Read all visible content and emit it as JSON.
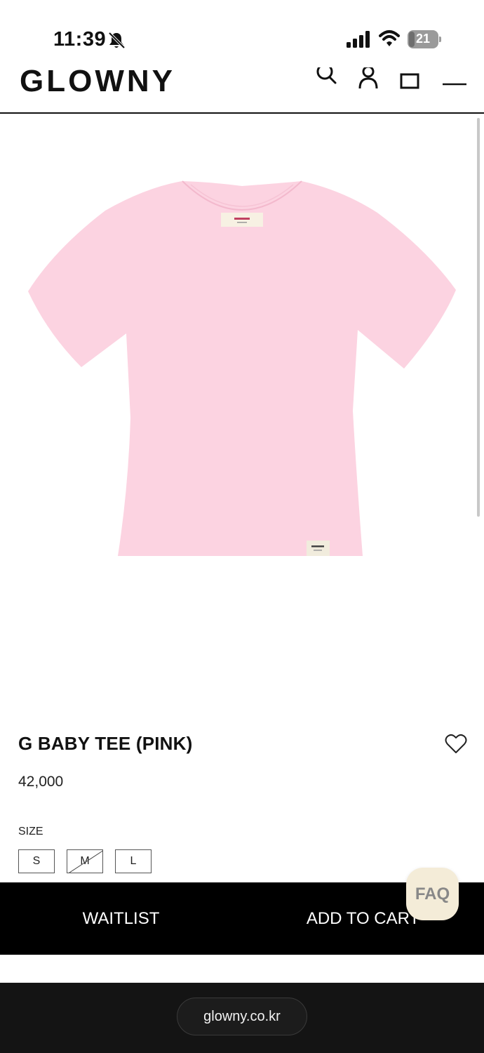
{
  "status_bar": {
    "time": "11:39",
    "battery": "21",
    "battery_fraction": 0.21
  },
  "header": {
    "logo": "GLOWNY",
    "icons": [
      "search-icon",
      "account-icon",
      "bag-icon",
      "menu-icon"
    ]
  },
  "product": {
    "title": "G BABY TEE (PINK)",
    "price": "42,000",
    "size_label": "SIZE",
    "sizes": [
      {
        "label": "S",
        "available": true
      },
      {
        "label": "M",
        "available": false
      },
      {
        "label": "L",
        "available": true
      }
    ],
    "garment_color": "#fcd3e1"
  },
  "actions": {
    "waitlist": "WAITLIST",
    "add_to_cart": "ADD TO CART",
    "faq": "FAQ"
  },
  "browser": {
    "url": "glowny.co.kr"
  }
}
